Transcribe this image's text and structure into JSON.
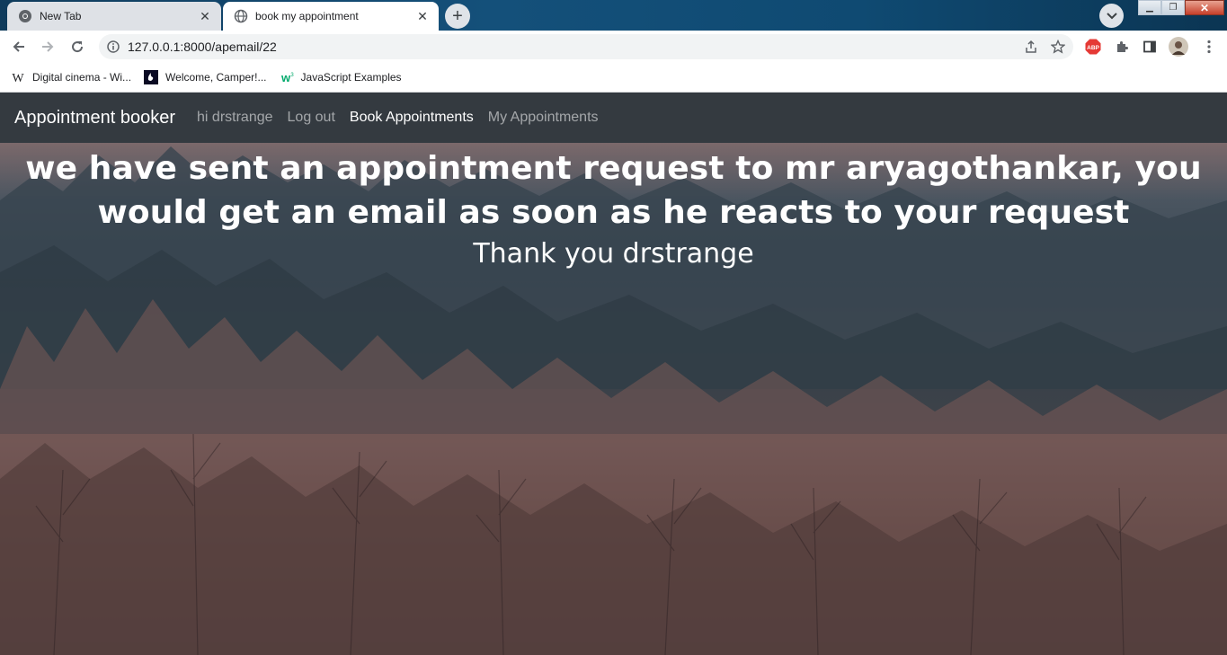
{
  "browser": {
    "tabs": [
      {
        "title": "New Tab",
        "active": false
      },
      {
        "title": "book my appointment",
        "active": true
      }
    ],
    "url": "127.0.0.1:8000/apemail/22",
    "bookmarks": [
      {
        "label": "Digital cinema - Wi...",
        "icon": "wikipedia-icon"
      },
      {
        "label": "Welcome, Camper!...",
        "icon": "freecodecamp-icon"
      },
      {
        "label": "JavaScript Examples",
        "icon": "w3schools-icon"
      }
    ],
    "extension_icons": [
      "adblock-plus-icon",
      "puzzle-extensions-icon",
      "side-panel-icon",
      "profile-avatar"
    ]
  },
  "app": {
    "brand": "Appointment booker",
    "nav": [
      {
        "label": "hi drstrange",
        "active": false
      },
      {
        "label": "Log out",
        "active": false
      },
      {
        "label": "Book Appointments",
        "active": true
      },
      {
        "label": "My Appointments",
        "active": false
      }
    ],
    "nav_bg": "#343a40"
  },
  "message": {
    "heading": "we have sent an appointment request to mr aryagothankar, you would get an email as soon as he reacts to your request",
    "thanks": "Thank you drstrange"
  }
}
